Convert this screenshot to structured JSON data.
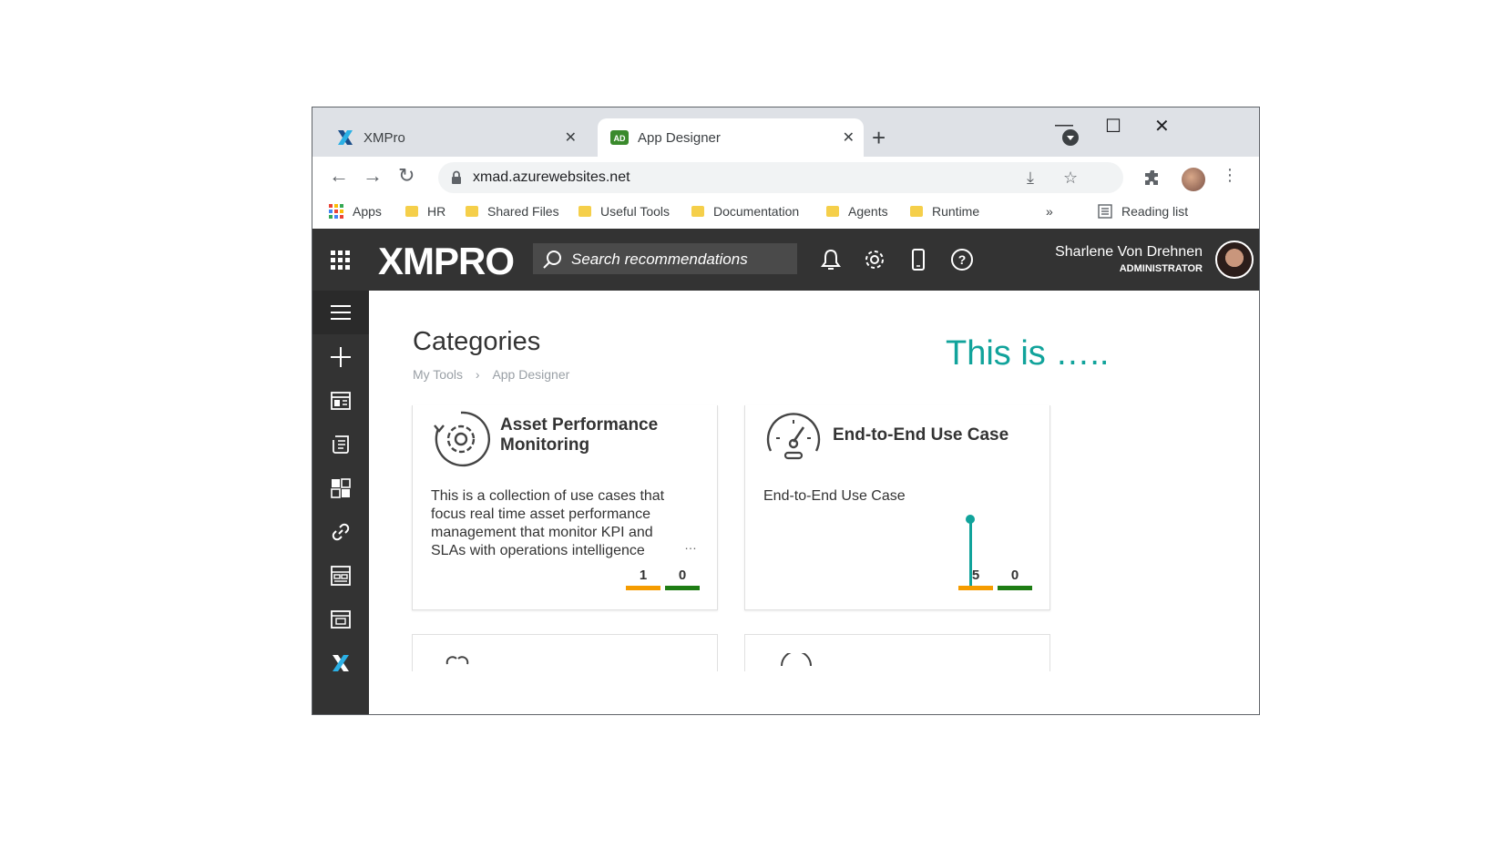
{
  "browser": {
    "tabs": [
      {
        "title": "XMPro",
        "active": false
      },
      {
        "title": "App Designer",
        "active": true
      }
    ],
    "url": "xmad.azurewebsites.net",
    "bookmarks": [
      "Apps",
      "HR",
      "Shared Files",
      "Useful Tools",
      "Documentation",
      "Agents",
      "Runtime"
    ],
    "more_bookmarks": "»",
    "reading_list": "Reading list"
  },
  "header": {
    "logo": "XMPRO",
    "search_placeholder": "Search recommendations",
    "user_name": "Sharlene Von Drehnen",
    "user_role": "ADMINISTRATOR"
  },
  "main": {
    "title": "Categories",
    "annotation": "This is …..",
    "breadcrumb": [
      "My Tools",
      "App Designer"
    ],
    "cards": [
      {
        "title": "Asset Performance Monitoring",
        "icon": "gear-cycle-icon",
        "description": "This is a collection of use cases that focus real time asset performance management that monitor KPI and SLAs with operations intelligence",
        "more": "…",
        "count_orange": "1",
        "count_green": "0"
      },
      {
        "title": "End-to-End Use Case",
        "icon": "gauge-icon",
        "description": "End-to-End Use Case",
        "count_orange": "5",
        "count_green": "0"
      }
    ]
  },
  "colors": {
    "accent_teal": "#11a39b",
    "orange": "#f59c00",
    "green": "#1e7d14",
    "header_bg": "#333333"
  }
}
